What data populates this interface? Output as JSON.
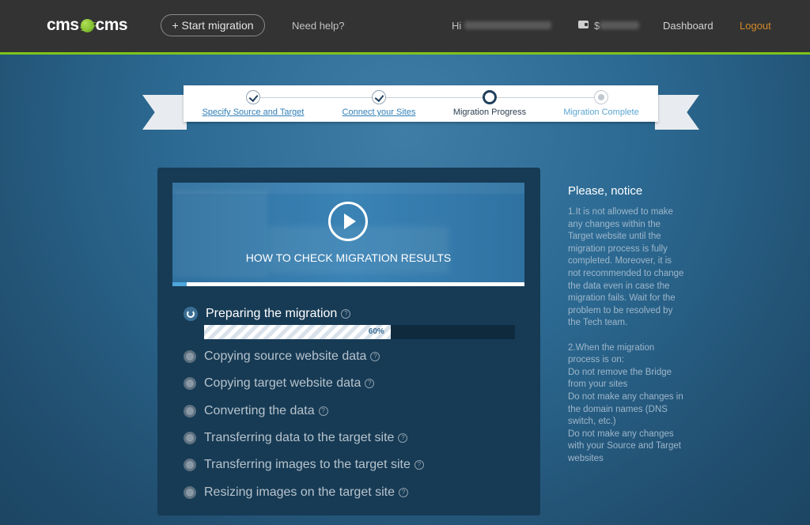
{
  "header": {
    "logo_left": "cms",
    "logo_right": "cms",
    "start_button": "+ Start migration",
    "help": "Need help?",
    "greeting": "Hi",
    "balance_prefix": "$",
    "dashboard": "Dashboard",
    "logout": "Logout",
    "logout_color": "#d08a2a",
    "accent_color": "#7fc31c"
  },
  "stepper": {
    "steps": [
      {
        "label": "Specify Source and Target",
        "state": "done"
      },
      {
        "label": "Connect your Sites",
        "state": "done"
      },
      {
        "label": "Migration Progress",
        "state": "current"
      },
      {
        "label": "Migration Complete",
        "state": "pending"
      }
    ]
  },
  "video": {
    "title": "HOW TO CHECK MIGRATION RESULTS",
    "icon": "play-icon"
  },
  "tasks": {
    "active": {
      "label": "Preparing the migration",
      "progress_label": "60%",
      "progress": 0.6
    },
    "pending": [
      {
        "label": "Copying source website data"
      },
      {
        "label": "Copying target website data"
      },
      {
        "label": "Converting the data"
      },
      {
        "label": "Transferring data to the target site"
      },
      {
        "label": "Transferring images to the target site"
      },
      {
        "label": "Resizing images on the target site"
      }
    ],
    "help_glyph": "?"
  },
  "notice": {
    "title": "Please, notice",
    "p1": "1.It is not allowed to make any changes within the Target website until the migration process is fully completed. Moreover, it is not recommended to change the data even in case the migration fails. Wait for the problem to be resolved by the Tech team.",
    "p2_lines": [
      "2.When the migration process is on:",
      "Do not remove the Bridge from your sites",
      "Do not make any changes in the domain names (DNS switch, etc.)",
      "Do not make any changes with your Source and Target websites"
    ]
  }
}
